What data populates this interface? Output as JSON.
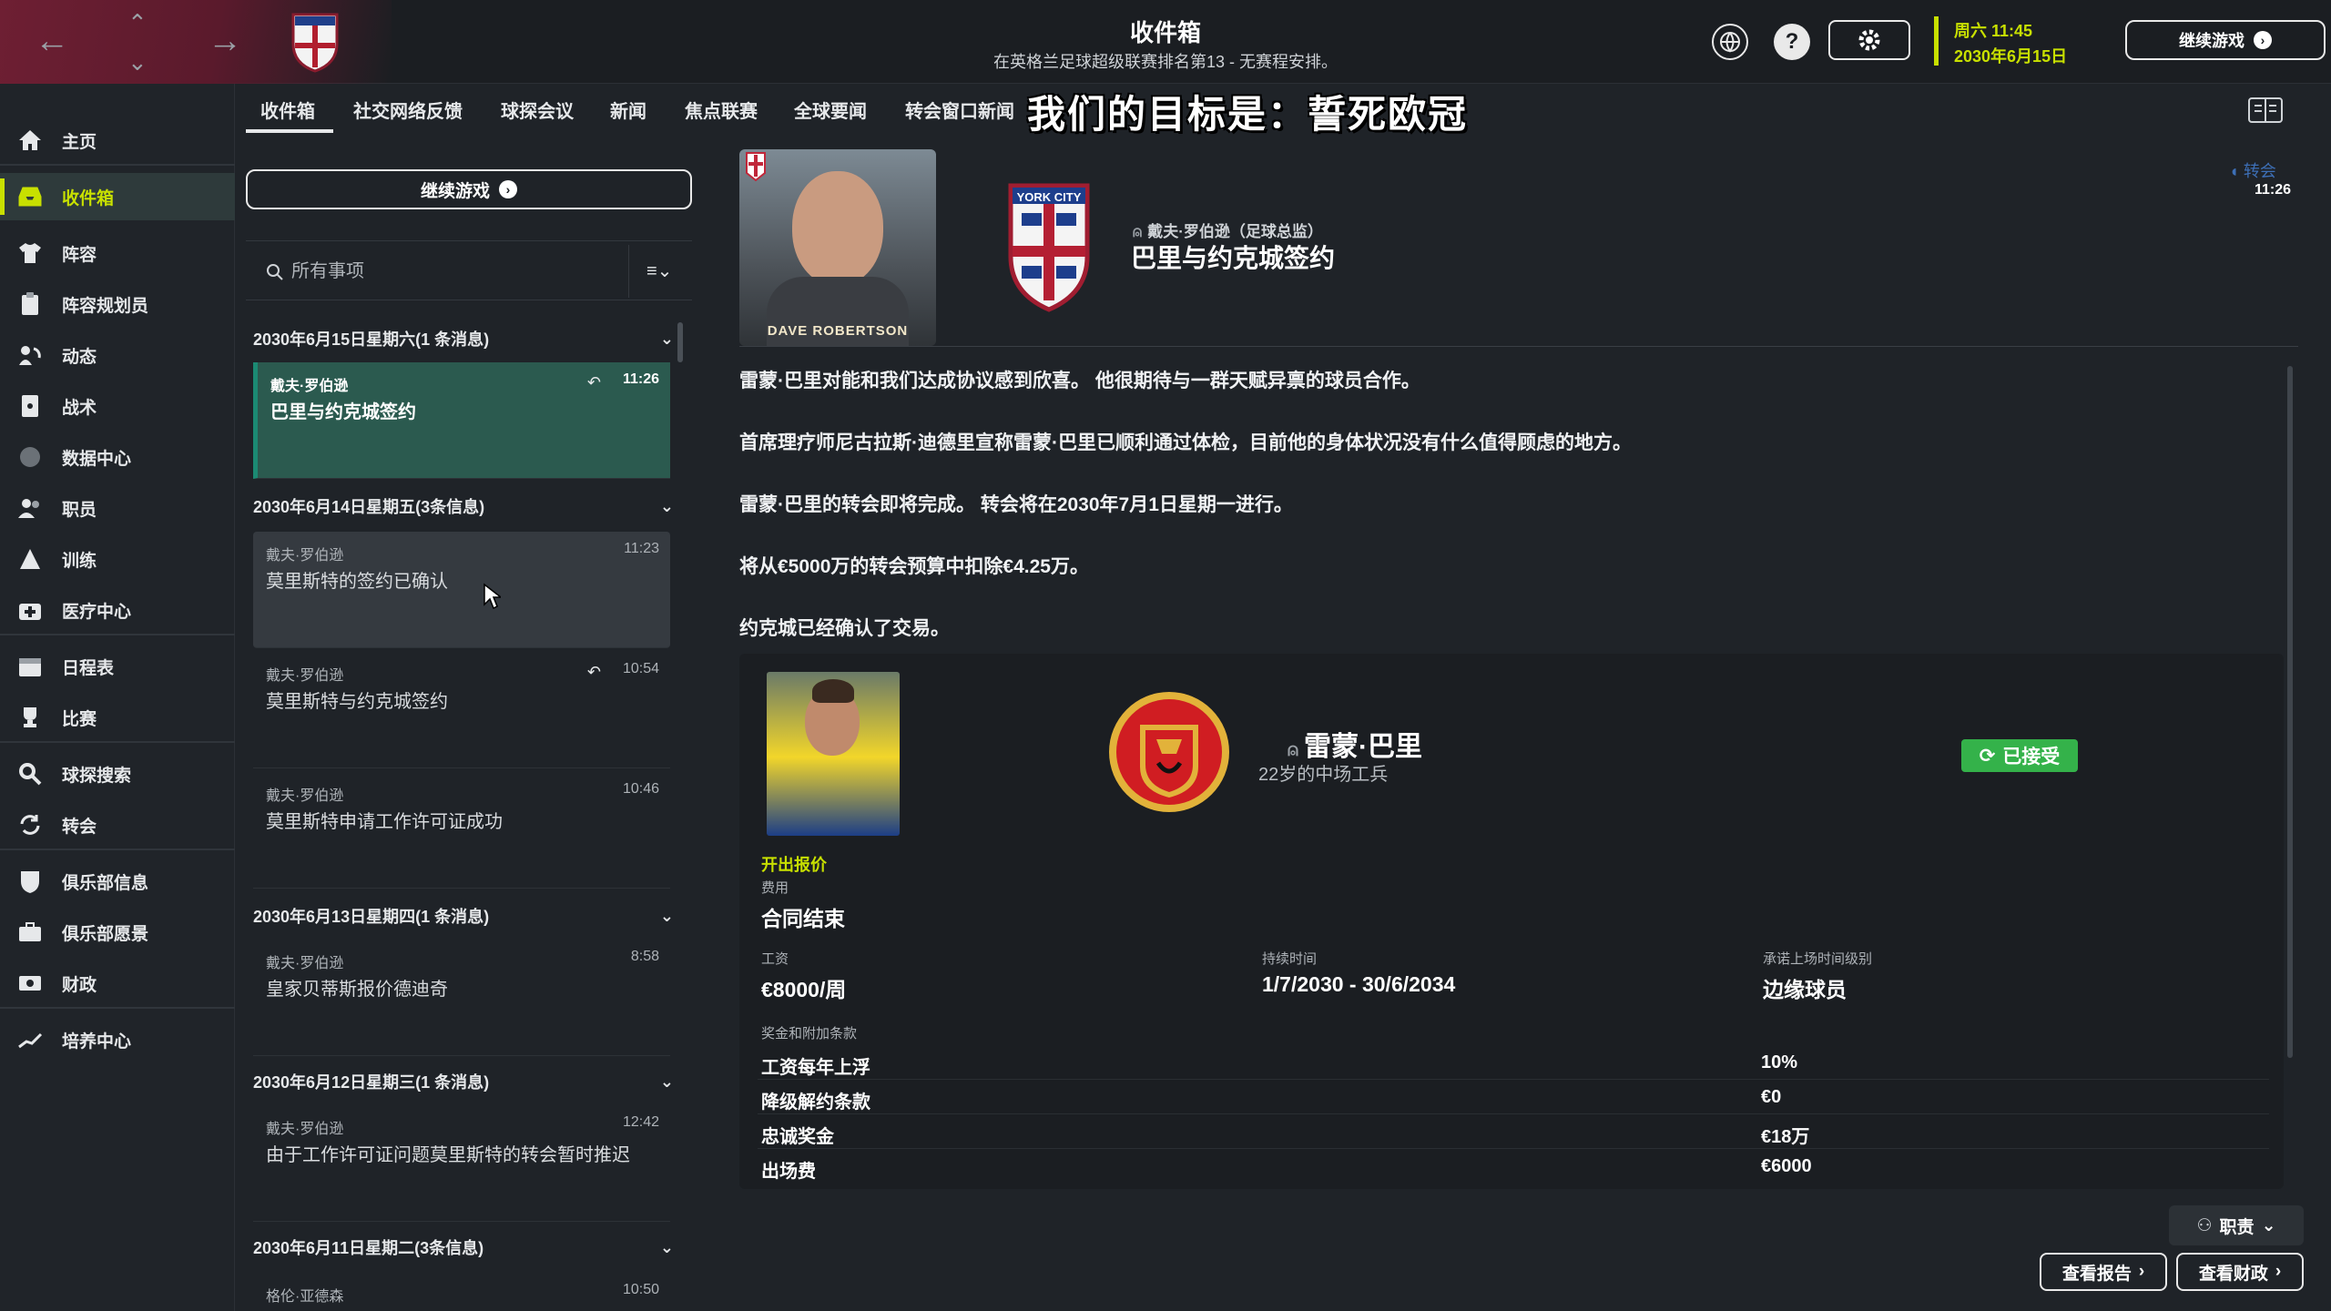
{
  "topbar": {
    "title": "收件箱",
    "subtitle": "在英格兰足球超级联赛排名第13 - 无赛程安排。",
    "date_line1": "周六 11:45",
    "date_line2": "2030年6月15日",
    "continue_label": "继续游戏"
  },
  "sidebar": {
    "items": [
      {
        "label": "主页",
        "icon": "home-icon"
      },
      {
        "label": "收件箱",
        "icon": "inbox-icon"
      },
      {
        "label": "阵容",
        "icon": "shirt-icon"
      },
      {
        "label": "阵容规划员",
        "icon": "clipboard-icon"
      },
      {
        "label": "动态",
        "icon": "dynamics-icon"
      },
      {
        "label": "战术",
        "icon": "tactics-icon"
      },
      {
        "label": "数据中心",
        "icon": "data-hub-icon"
      },
      {
        "label": "职员",
        "icon": "staff-icon"
      },
      {
        "label": "训练",
        "icon": "training-icon"
      },
      {
        "label": "医疗中心",
        "icon": "medical-icon"
      },
      {
        "label": "日程表",
        "icon": "calendar-icon"
      },
      {
        "label": "比赛",
        "icon": "trophy-icon"
      },
      {
        "label": "球探搜索",
        "icon": "search-icon"
      },
      {
        "label": "转会",
        "icon": "transfer-icon"
      },
      {
        "label": "俱乐部信息",
        "icon": "shield-icon"
      },
      {
        "label": "俱乐部愿景",
        "icon": "briefcase-icon"
      },
      {
        "label": "财政",
        "icon": "finance-icon"
      },
      {
        "label": "培养中心",
        "icon": "development-icon"
      }
    ]
  },
  "tabs": [
    "收件箱",
    "社交网络反馈",
    "球探会议",
    "新闻",
    "焦点联赛",
    "全球要闻",
    "转会窗口新闻"
  ],
  "motto": "我们的目标是：誓死欧冠",
  "list": {
    "continue_label": "继续游戏",
    "search_placeholder": "所有事项",
    "groups": [
      {
        "header": "2030年6月15日星期六(1 条消息)"
      },
      {
        "header": "2030年6月14日星期五(3条信息)"
      },
      {
        "header": "2030年6月13日星期四(1 条消息)"
      },
      {
        "header": "2030年6月12日星期三(1 条消息)"
      },
      {
        "header": "2030年6月11日星期二(3条信息)"
      }
    ],
    "messages": [
      {
        "sender": "戴夫·罗伯逊",
        "subject": "巴里与约克城签约",
        "time": "11:26"
      },
      {
        "sender": "戴夫·罗伯逊",
        "subject": "莫里斯特的签约已确认",
        "time": "11:23"
      },
      {
        "sender": "戴夫·罗伯逊",
        "subject": "莫里斯特与约克城签约",
        "time": "10:54"
      },
      {
        "sender": "戴夫·罗伯逊",
        "subject": "莫里斯特申请工作许可证成功",
        "time": "10:46"
      },
      {
        "sender": "戴夫·罗伯逊",
        "subject": "皇家贝蒂斯报价德迪奇",
        "time": "8:58"
      },
      {
        "sender": "戴夫·罗伯逊",
        "subject": "由于工作许可证问题莫里斯特的转会暂时推迟",
        "time": "12:42"
      },
      {
        "sender": "格伦·亚德森",
        "subject": "",
        "time": "10:50"
      }
    ]
  },
  "detail": {
    "manager_name_tag": "DAVE ROBERTSON",
    "from": "戴夫·罗伯逊（足球总监）",
    "title": "巴里与约克城签约",
    "category": "转会",
    "time": "11:26",
    "paragraphs": [
      "雷蒙·巴里对能和我们达成协议感到欣喜。 他很期待与一群天赋异禀的球员合作。",
      "首席理疗师尼古拉斯·迪德里宣称雷蒙·巴里已顺利通过体检，目前他的身体状况没有什么值得顾虑的地方。",
      "雷蒙·巴里的转会即将完成。 转会将在2030年7月1日星期一进行。",
      "将从€5000万的转会预算中扣除€4.25万。",
      "约克城已经确认了交易。"
    ],
    "player": {
      "name": "雷蒙·巴里",
      "desc": "22岁的中场工兵",
      "status": "已接受",
      "offer_link": "开出报价",
      "fee_label": "费用",
      "fee_value": "合同结束",
      "wage_label": "工资",
      "wage_value": "€8000/周",
      "duration_label": "持续时间",
      "duration_value": "1/7/2030 - 30/6/2034",
      "playing_time_label": "承诺上场时间级别",
      "playing_time_value": "边缘球员",
      "bonus_header": "奖金和附加条款",
      "bonuses": [
        {
          "k": "工资每年上浮",
          "v": "10%"
        },
        {
          "k": "降级解约条款",
          "v": "€0"
        },
        {
          "k": "忠诚奖金",
          "v": "€18万"
        },
        {
          "k": "出场费",
          "v": "€6000"
        }
      ]
    },
    "duty_label": "职责",
    "view_report_label": "查看报告",
    "view_finance_label": "查看财政"
  }
}
